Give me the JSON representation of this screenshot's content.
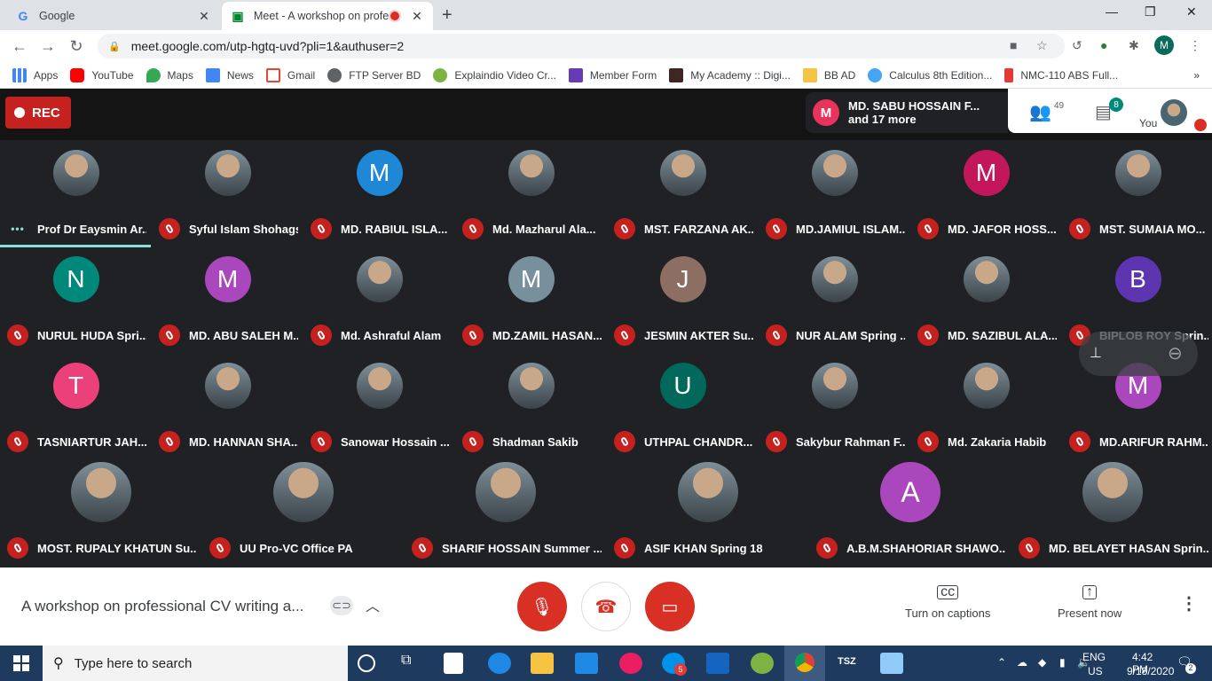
{
  "browser": {
    "tabs": [
      {
        "title": "Google",
        "active": false
      },
      {
        "title": "Meet - A workshop on profe",
        "active": true
      }
    ],
    "url": "meet.google.com/utp-hgtq-uvd?pli=1&authuser=2",
    "profile_initial": "M",
    "bookmarks": [
      "Apps",
      "YouTube",
      "Maps",
      "News",
      "Gmail",
      "FTP Server BD",
      "Explaindio Video Cr...",
      "Member Form",
      "My Academy :: Digi...",
      "BB AD",
      "Calculus 8th Edition...",
      "NMC-110 ABS Full..."
    ]
  },
  "meet": {
    "rec_label": "REC",
    "presenter_initial": "M",
    "presenter_name": "MD. SABU HOSSAIN F...",
    "presenter_more": "and 17 more",
    "people_count": "49",
    "chat_badge": "8",
    "you_label": "You",
    "participants": [
      {
        "name": "Prof Dr Eaysmin Ar...",
        "initial": "",
        "color": "#6d4c41",
        "speaking": true
      },
      {
        "name": "Syful Islam Shohags",
        "initial": "",
        "color": "#5d6d7e"
      },
      {
        "name": "MD. RABIUL ISLA...",
        "initial": "M",
        "color": "#1e88d6"
      },
      {
        "name": "Md. Mazharul Ala...",
        "initial": "",
        "color": "#4a6572"
      },
      {
        "name": "MST. FARZANA AK...",
        "initial": "",
        "color": "#3e2723"
      },
      {
        "name": "MD.JAMIUL ISLAM...",
        "initial": "",
        "color": "#558b6e"
      },
      {
        "name": "MD. JAFOR HOSS...",
        "initial": "M",
        "color": "#c2185b"
      },
      {
        "name": "MST. SUMAIA MO...",
        "initial": "",
        "color": "#37474f"
      },
      {
        "name": "NURUL HUDA Spri...",
        "initial": "N",
        "color": "#00897b"
      },
      {
        "name": "MD. ABU SALEH M...",
        "initial": "M",
        "color": "#ab47bc"
      },
      {
        "name": "Md. Ashraful Alam",
        "initial": "",
        "color": "#eceff1"
      },
      {
        "name": "MD.ZAMIL HASAN...",
        "initial": "M",
        "color": "#78909c"
      },
      {
        "name": "JESMIN AKTER Su...",
        "initial": "J",
        "color": "#8d6e63"
      },
      {
        "name": "NUR ALAM Spring ...",
        "initial": "",
        "color": "#8a9a7a"
      },
      {
        "name": "MD. SAZIBUL ALA...",
        "initial": "",
        "color": "#f5f5f5"
      },
      {
        "name": "BIPLOB ROY Sprin...",
        "initial": "B",
        "color": "#5e35b1"
      },
      {
        "name": "TASNIARTUR JAH...",
        "initial": "T",
        "color": "#ec407a"
      },
      {
        "name": "MD. HANNAN SHA...",
        "initial": "",
        "color": "#cfd8dc"
      },
      {
        "name": "Sanowar Hossain ...",
        "initial": "",
        "color": "#a1887f"
      },
      {
        "name": "Shadman Sakib",
        "initial": "",
        "color": "#7a8a6a"
      },
      {
        "name": "UTHPAL CHANDR...",
        "initial": "U",
        "color": "#00695c"
      },
      {
        "name": "Sakybur Rahman F...",
        "initial": "",
        "color": "#263238"
      },
      {
        "name": "Md. Zakaria Habib",
        "initial": "",
        "color": "#d7ccc8"
      },
      {
        "name": "MD.ARIFUR RAHM...",
        "initial": "M",
        "color": "#ab47bc"
      },
      {
        "name": "MOST. RUPALY KHATUN Su...",
        "initial": "",
        "color": "#8d5b5b"
      },
      {
        "name": "UU Pro-VC Office PA",
        "initial": "",
        "color": "#eceff1"
      },
      {
        "name": "SHARIF HOSSAIN Summer ...",
        "initial": "",
        "color": "#6d7a5a"
      },
      {
        "name": "ASIF KHAN Spring 18",
        "initial": "",
        "color": "#a1b8c0"
      },
      {
        "name": "A.B.M.SHAHORIAR SHAWO...",
        "initial": "A",
        "color": "#ab47bc"
      },
      {
        "name": "MD. BELAYET HASAN Sprin...",
        "initial": "",
        "color": "#5a6a4a"
      }
    ],
    "meeting_title": "A workshop on professional CV writing a...",
    "captions_label": "Turn on captions",
    "present_label": "Present now"
  },
  "taskbar": {
    "search_placeholder": "Type here to search",
    "lang": "ENG",
    "region": "US",
    "time": "4:42 PM",
    "date": "9/18/2020",
    "notif_count": "2",
    "messenger_badge": "5"
  },
  "colors": {
    "accent_red": "#d93025",
    "meet_bg": "#202124",
    "teal": "#8be0d6"
  }
}
